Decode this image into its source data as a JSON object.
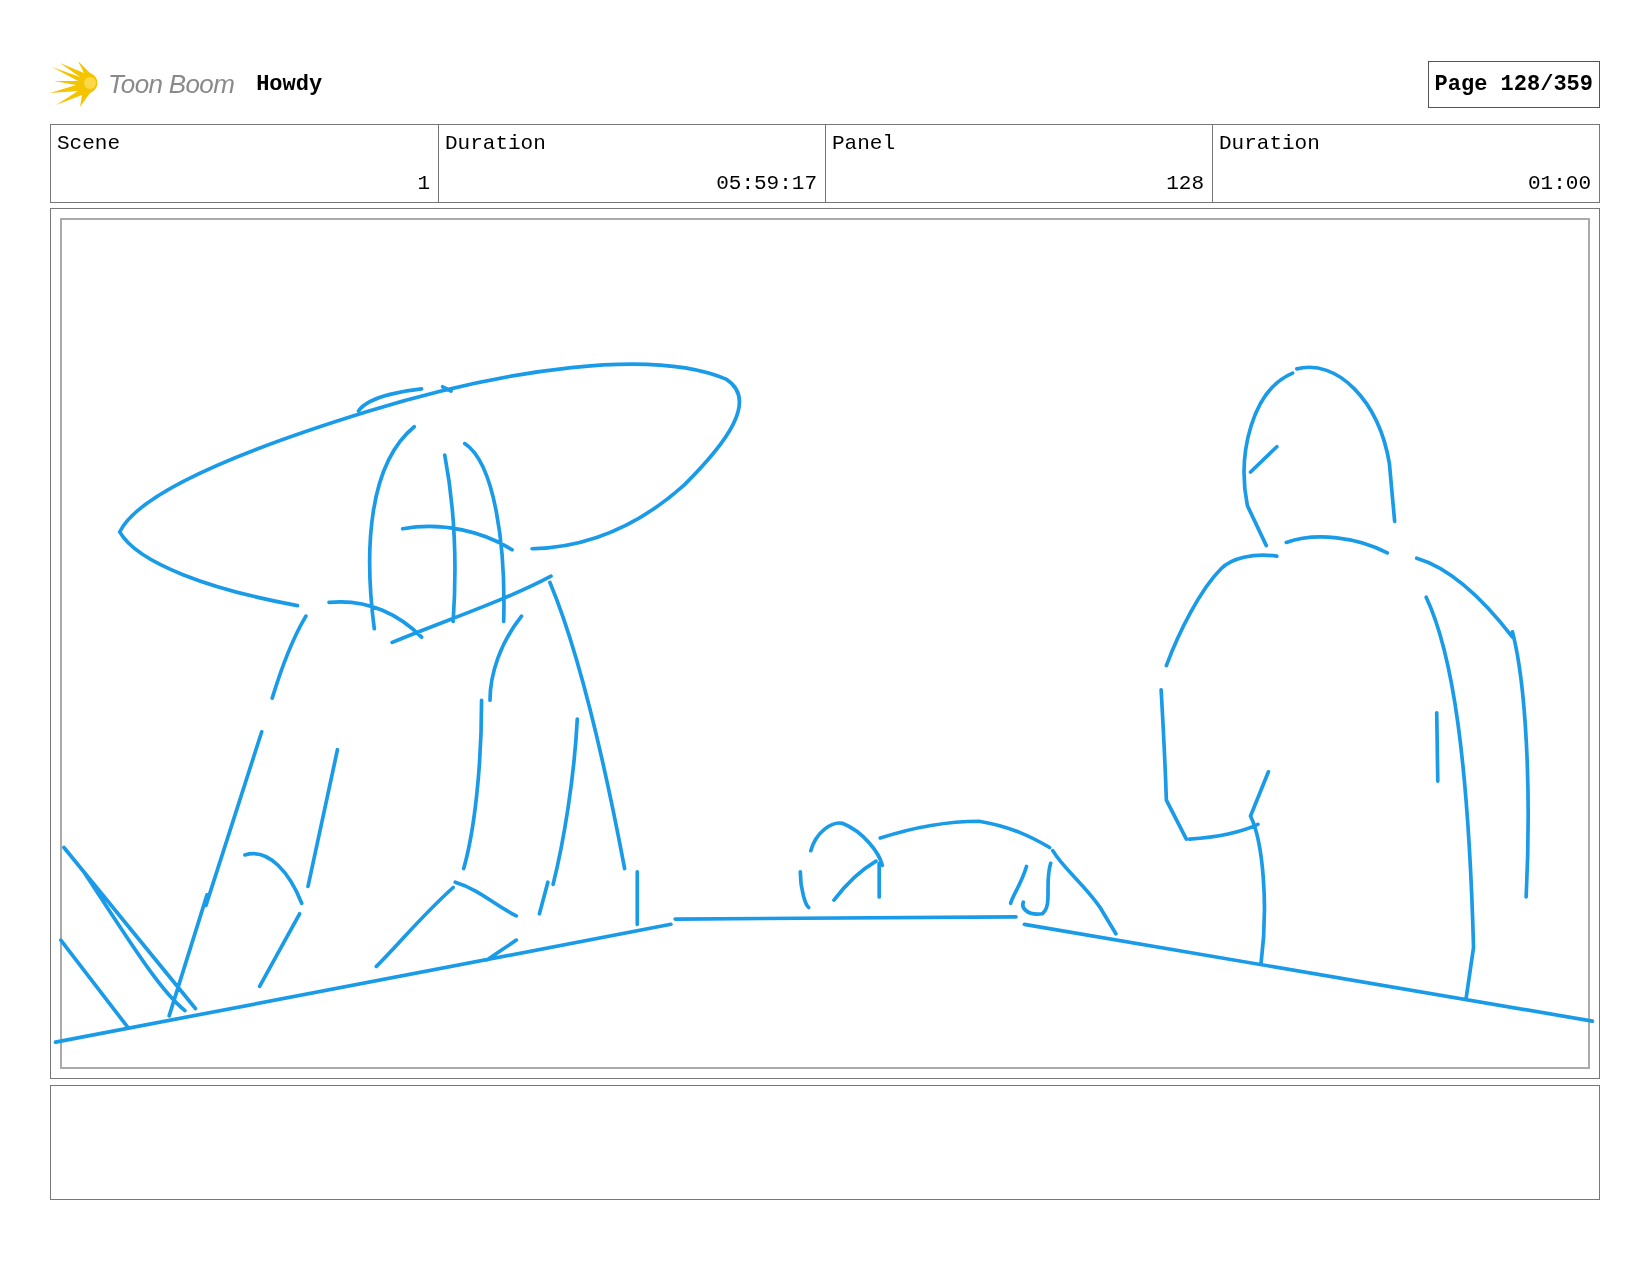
{
  "header": {
    "logo_text": "Toon Boom",
    "project_title": "Howdy",
    "page": "Page 128/359"
  },
  "info_table": {
    "columns": [
      "Scene",
      "Duration",
      "Panel",
      "Duration"
    ],
    "row": [
      "1",
      "05:59:17",
      "128",
      "01:00"
    ]
  }
}
